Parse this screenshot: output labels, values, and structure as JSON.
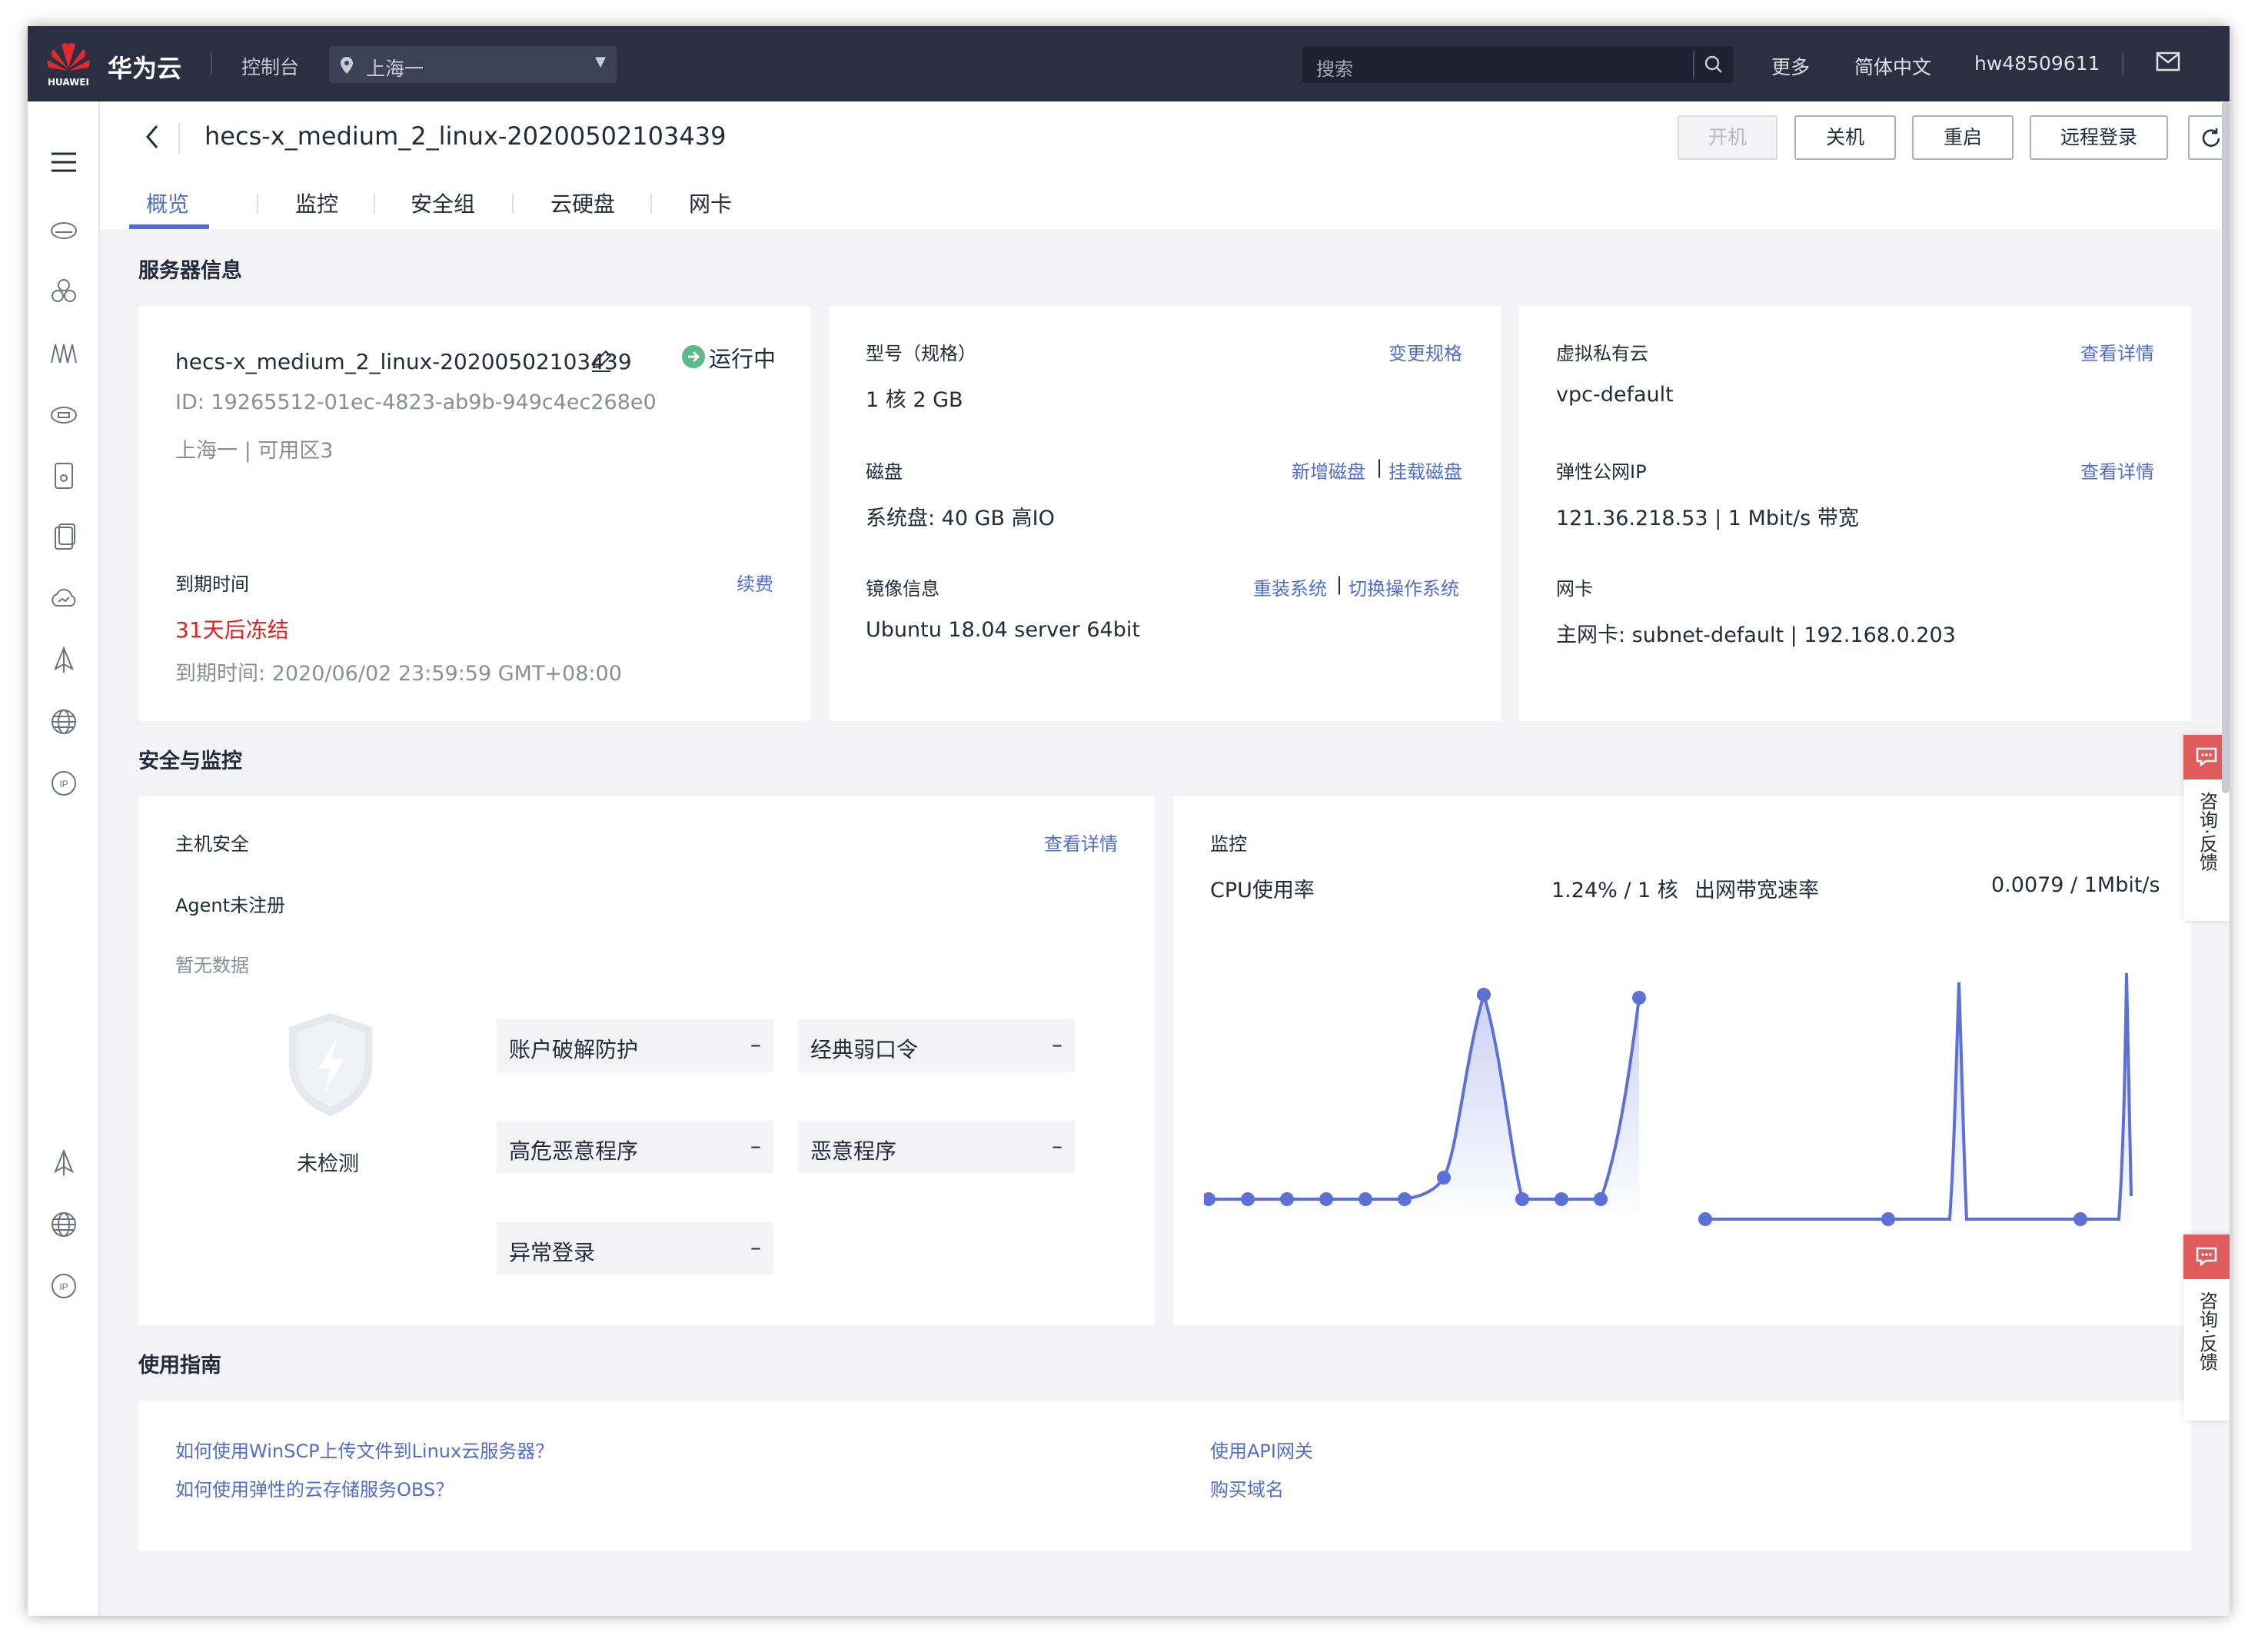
{
  "topbar": {
    "logo_text": "HUAWEI",
    "brand": "华为云",
    "console": "控制台",
    "region": "上海一",
    "search_placeholder": "搜索",
    "more": "更多",
    "language": "简体中文",
    "username": "hw48509611"
  },
  "header": {
    "title": "hecs-x_medium_2_linux-20200502103439",
    "buttons": {
      "start": "开机",
      "shutdown": "关机",
      "restart": "重启",
      "remote_login": "远程登录"
    },
    "tabs": [
      "概览",
      "监控",
      "安全组",
      "云硬盘",
      "网卡"
    ]
  },
  "server_info": {
    "section_title": "服务器信息",
    "name": "hecs-x_medium_2_linux-20200502103439",
    "status": "运行中",
    "id": "ID: 19265512-01ec-4823-ab9b-949c4ec268e0",
    "location": "上海一 | 可用区3",
    "expire_label": "到期时间",
    "renew": "续费",
    "freeze_warning": "31天后冻结",
    "expire_time": "到期时间: 2020/06/02 23:59:59 GMT+08:00",
    "spec_label": "型号（规格）",
    "spec_change": "变更规格",
    "spec_value": "1 核 2 GB",
    "disk_label": "磁盘",
    "disk_add": "新增磁盘",
    "disk_attach": "挂载磁盘",
    "disk_value": "系统盘: 40 GB 高IO",
    "image_label": "镜像信息",
    "image_reinstall": "重装系统",
    "image_switch": "切换操作系统",
    "image_value": "Ubuntu 18.04 server 64bit",
    "vpc_label": "虚拟私有云",
    "vpc_detail": "查看详情",
    "vpc_value": "vpc-default",
    "eip_label": "弹性公网IP",
    "eip_detail": "查看详情",
    "eip_value": "121.36.218.53  |  1 Mbit/s 带宽",
    "nic_label": "网卡",
    "nic_value": "主网卡: subnet-default  |  192.168.0.203"
  },
  "security": {
    "section_title": "安全与监控",
    "host_security": "主机安全",
    "detail": "查看详情",
    "agent": "Agent未注册",
    "no_data": "暂无数据",
    "undetected": "未检测",
    "items": [
      {
        "name": "账户破解防护",
        "value": "–"
      },
      {
        "name": "经典弱口令",
        "value": "–"
      },
      {
        "name": "高危恶意程序",
        "value": "–"
      },
      {
        "name": "恶意程序",
        "value": "–"
      },
      {
        "name": "异常登录",
        "value": "–"
      }
    ],
    "monitor_title": "监控",
    "cpu_label": "CPU使用率",
    "cpu_value": "1.24% / 1 核",
    "bw_label": "出网带宽速率",
    "bw_value": "0.0079 / 1Mbit/s"
  },
  "guide": {
    "section_title": "使用指南",
    "links": [
      "如何使用WinSCP上传文件到Linux云服务器？",
      "如何使用弹性的云存储服务OBS？",
      "使用API网关",
      "购买域名"
    ]
  },
  "feedback": {
    "text": "咨询·反馈"
  },
  "colors": {
    "accent": "#526ecc",
    "topbar": "#2a2f41",
    "warning": "#e02020",
    "running": "#5bb98c"
  }
}
